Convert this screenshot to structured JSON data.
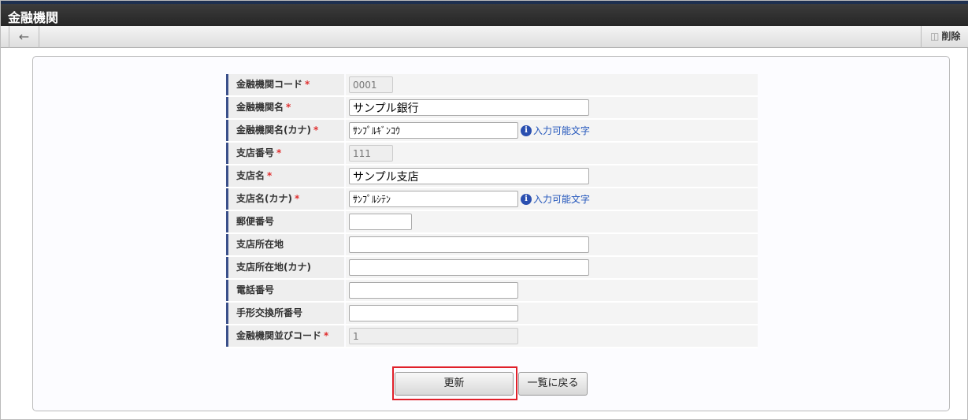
{
  "title": "金融機関",
  "toolbar": {
    "back_icon": "←",
    "delete_label": "削除",
    "delete_icon": "🗑"
  },
  "form": {
    "required_mark": "*",
    "hint_label": "入力可能文字",
    "hint_icon": "i",
    "rows": [
      {
        "label": "金融機関コード",
        "value": "0001"
      },
      {
        "label": "金融機関名",
        "value": "サンプル銀行"
      },
      {
        "label": "金融機関名(カナ)",
        "value": "ｻﾝﾌﾟﾙｷﾞﾝｺｳ"
      },
      {
        "label": "支店番号",
        "value": "111"
      },
      {
        "label": "支店名",
        "value": "サンプル支店"
      },
      {
        "label": "支店名(カナ)",
        "value": "ｻﾝﾌﾟﾙｼﾃﾝ"
      },
      {
        "label": "郵便番号",
        "value": ""
      },
      {
        "label": "支店所在地",
        "value": ""
      },
      {
        "label": "支店所在地(カナ)",
        "value": ""
      },
      {
        "label": "電話番号",
        "value": ""
      },
      {
        "label": "手形交換所番号",
        "value": ""
      },
      {
        "label": "金融機関並びコード",
        "value": "1"
      }
    ]
  },
  "buttons": {
    "update": "更新",
    "back_to_list": "一覧に戻る"
  }
}
